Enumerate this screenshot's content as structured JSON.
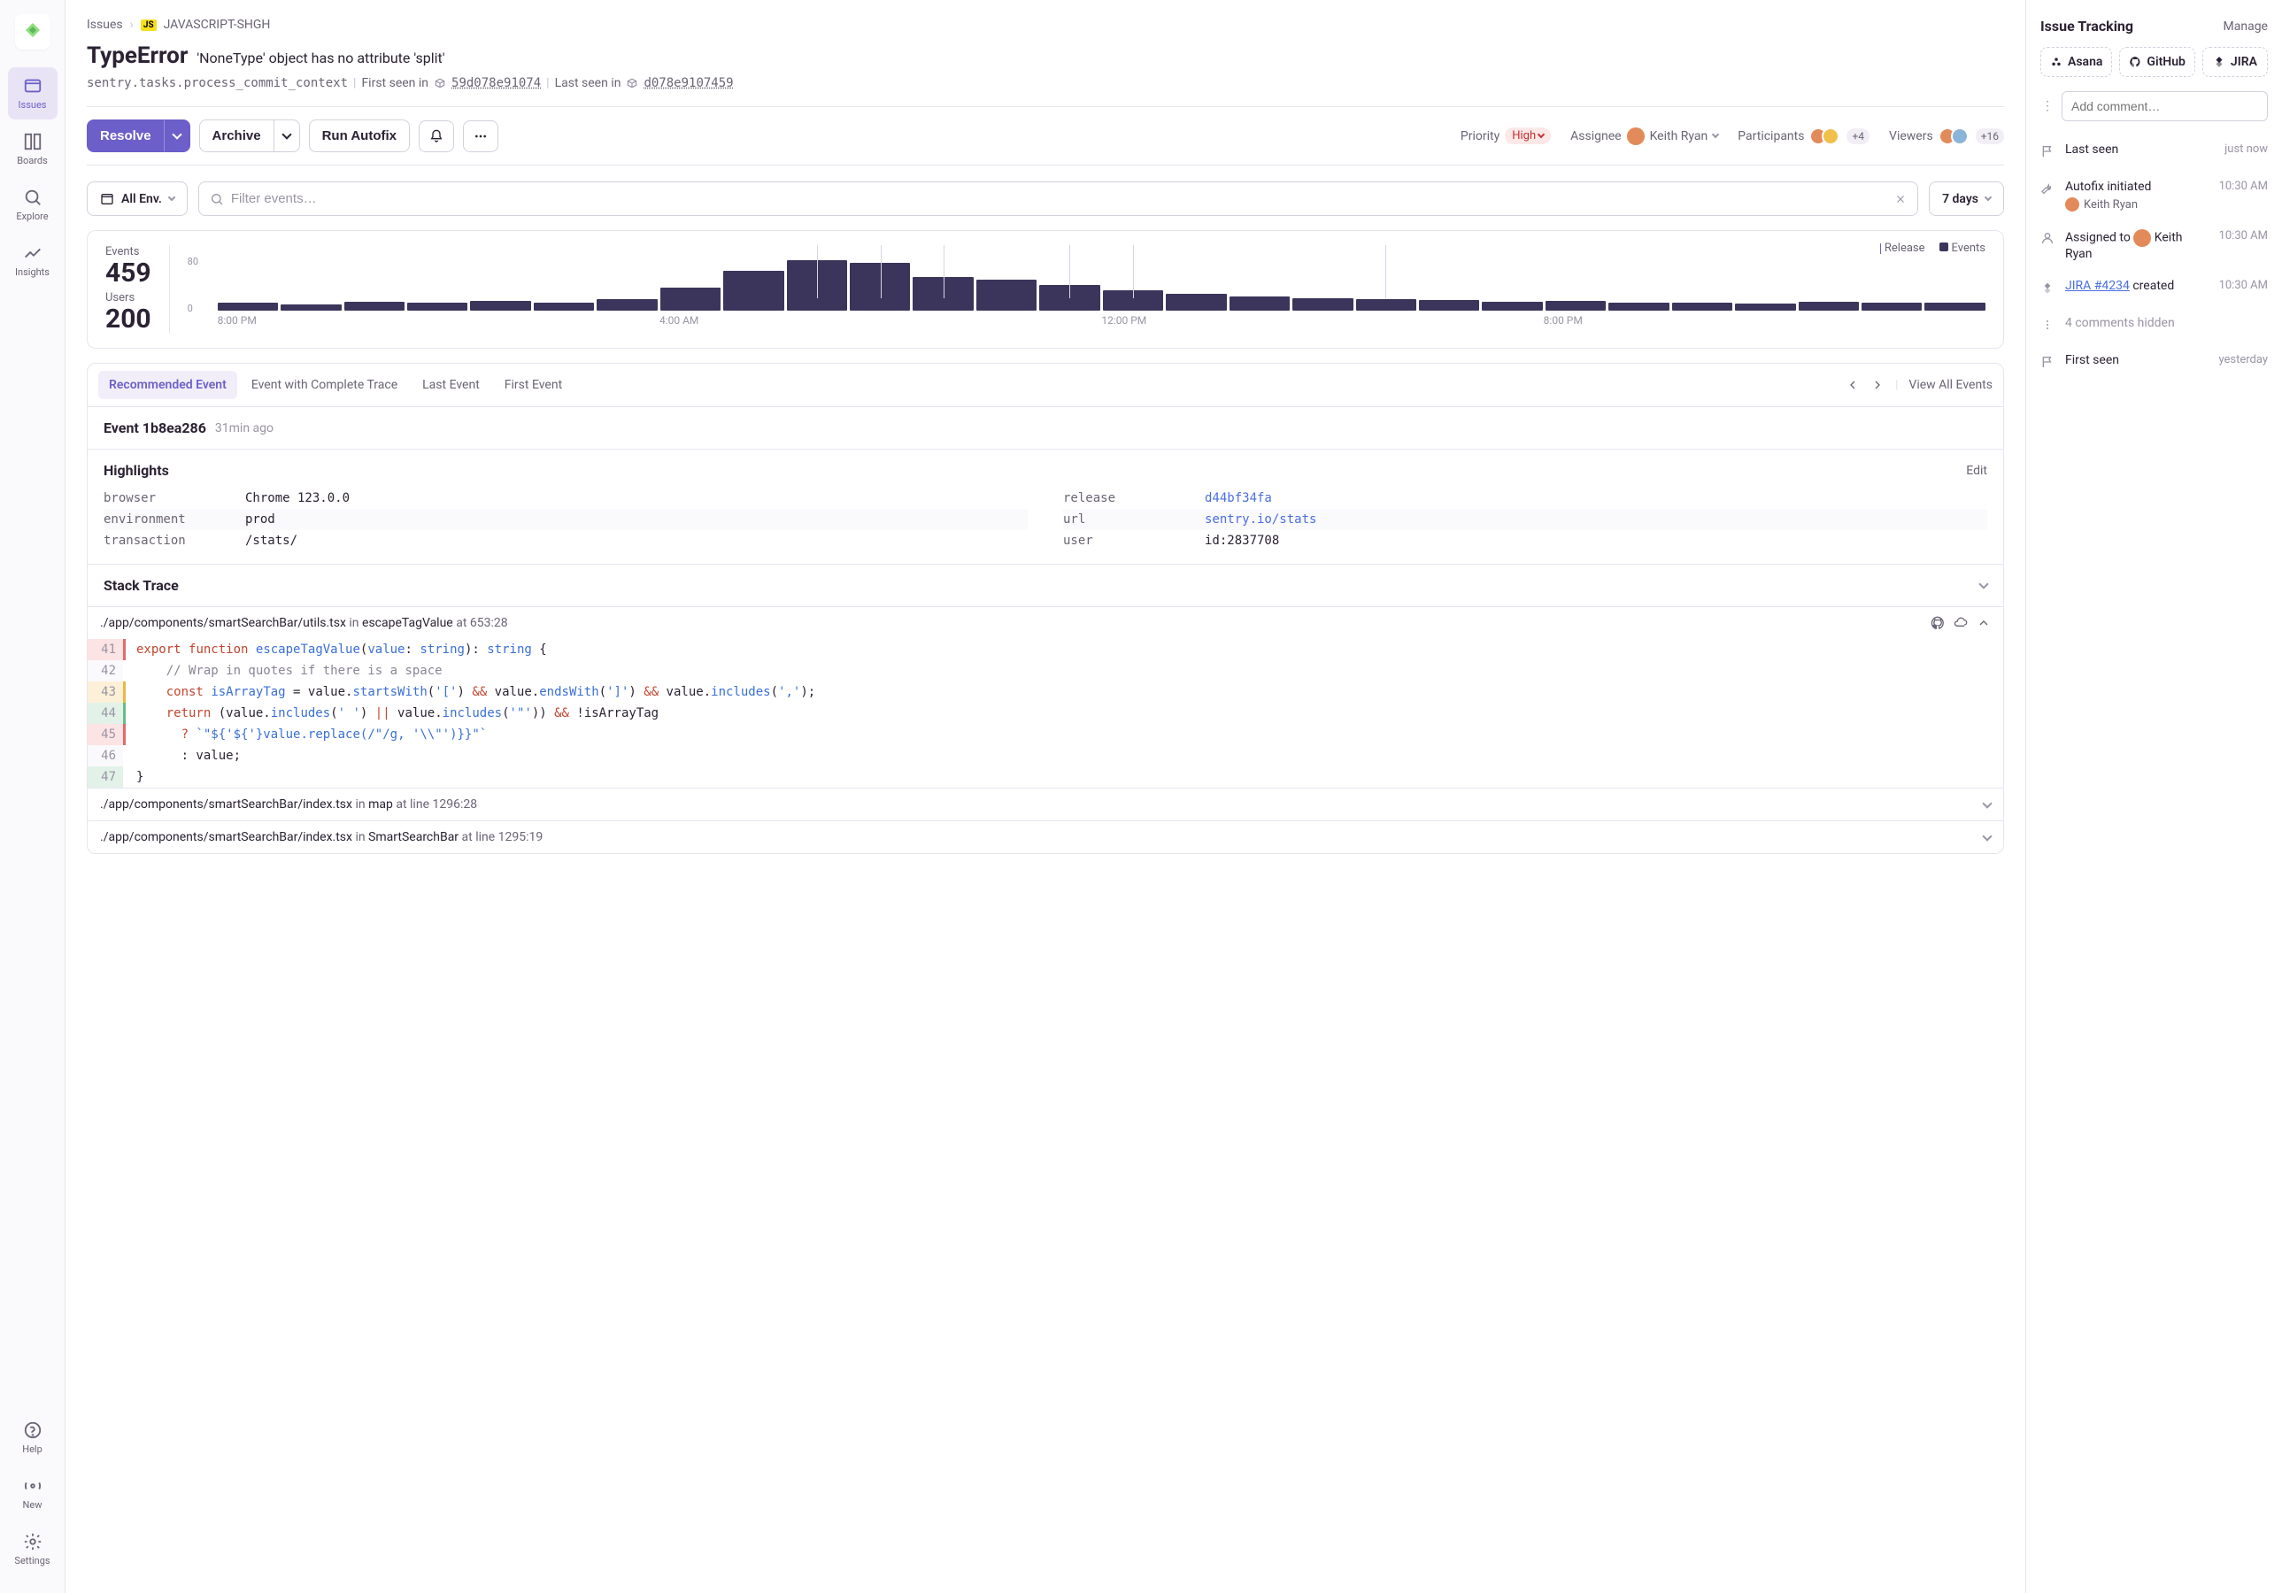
{
  "nav": {
    "items": [
      "Issues",
      "Boards",
      "Explore",
      "Insights"
    ],
    "bottom": [
      "Help",
      "New",
      "Settings"
    ]
  },
  "breadcrumb": {
    "root": "Issues",
    "project_badge": "JS",
    "project": "JAVASCRIPT-SHGH"
  },
  "issue": {
    "type": "TypeError",
    "message": "'NoneType' object has no attribute 'split'",
    "transaction": "sentry.tasks.process_commit_context",
    "first_seen_label": "First seen in",
    "first_seen_version": "59d078e91074",
    "last_seen_label": "Last seen in",
    "last_seen_version": "d078e9107459"
  },
  "toolbar": {
    "resolve": "Resolve",
    "archive": "Archive",
    "autofix": "Run Autofix",
    "priority_label": "Priority",
    "priority_value": "High",
    "assignee_label": "Assignee",
    "assignee_name": "Keith Ryan",
    "participants_label": "Participants",
    "participants_count": "+4",
    "viewers_label": "Viewers",
    "viewers_count": "+16"
  },
  "filters": {
    "env": "All Env.",
    "search_placeholder": "Filter events…",
    "range": "7 days"
  },
  "stats": {
    "events_label": "Events",
    "events_value": "459",
    "users_label": "Users",
    "users_value": "200"
  },
  "chart_data": {
    "type": "bar",
    "ylim": [
      0,
      80
    ],
    "ylabel": "",
    "legend": [
      "Release",
      "Events"
    ],
    "x_ticks": [
      "8:00 PM",
      "4:00 AM",
      "12:00 PM",
      "8:00 PM"
    ],
    "release_markers": [
      9,
      10,
      11,
      13,
      14,
      18
    ],
    "values": [
      12,
      10,
      14,
      12,
      15,
      13,
      18,
      36,
      62,
      78,
      74,
      52,
      48,
      40,
      32,
      26,
      22,
      20,
      18,
      16,
      14,
      15,
      12,
      13,
      11,
      14,
      13,
      12
    ]
  },
  "event_tabs": [
    "Recommended Event",
    "Event with Complete Trace",
    "Last Event",
    "First Event"
  ],
  "event_tabs_active": 0,
  "view_all": "View All Events",
  "event": {
    "title": "Event 1b8ea286",
    "ago": "31min ago"
  },
  "highlights": {
    "title": "Highlights",
    "edit": "Edit",
    "left": [
      {
        "k": "browser",
        "v": "Chrome 123.0.0"
      },
      {
        "k": "environment",
        "v": "prod"
      },
      {
        "k": "transaction",
        "v": "/stats/"
      }
    ],
    "right": [
      {
        "k": "release",
        "v": "d44bf34fa",
        "link": true
      },
      {
        "k": "url",
        "v": "sentry.io/stats",
        "link": true
      },
      {
        "k": "user",
        "v": "id:2837708"
      }
    ]
  },
  "stack": {
    "title": "Stack Trace",
    "frames": [
      {
        "path": "./app/components/smartSearchBar/utils.tsx",
        "in": "in",
        "fn": "escapeTagValue",
        "at": "at",
        "loc": "653:28",
        "expanded": true
      },
      {
        "path": "./app/components/smartSearchBar/index.tsx",
        "in": "in",
        "fn": "map",
        "at": "at",
        "loc": "line 1296:28",
        "expanded": false
      },
      {
        "path": "./app/components/smartSearchBar/index.tsx",
        "in": "in",
        "fn": "SmartSearchBar",
        "at": "at",
        "loc": "line 1295:19",
        "expanded": false
      }
    ],
    "code": [
      {
        "n": 41,
        "cls": "l41"
      },
      {
        "n": 42,
        "cls": ""
      },
      {
        "n": 43,
        "cls": "l43"
      },
      {
        "n": 44,
        "cls": "l44"
      },
      {
        "n": 45,
        "cls": "l45"
      },
      {
        "n": 46,
        "cls": ""
      },
      {
        "n": 47,
        "cls": "l47"
      }
    ]
  },
  "right": {
    "title": "Issue Tracking",
    "manage": "Manage",
    "trackers": [
      "Asana",
      "GitHub",
      "JIRA"
    ],
    "comment_placeholder": "Add comment…",
    "activity": [
      {
        "icon": "flag",
        "title": "Last seen",
        "time": "just now"
      },
      {
        "icon": "wrench",
        "title": "Autofix initiated",
        "sub_user": "Keith Ryan",
        "time": "10:30 AM"
      },
      {
        "icon": "user",
        "title_prefix": "Assigned to ",
        "title_user": "Keith Ryan",
        "time": "10:30 AM"
      },
      {
        "icon": "jira",
        "title_link": "JIRA #4234",
        "title_suffix": " created",
        "time": "10:30 AM"
      },
      {
        "icon": "dots",
        "title": "4 comments hidden",
        "muted": true
      },
      {
        "icon": "flag",
        "title": "First seen",
        "time": "yesterday"
      }
    ]
  }
}
